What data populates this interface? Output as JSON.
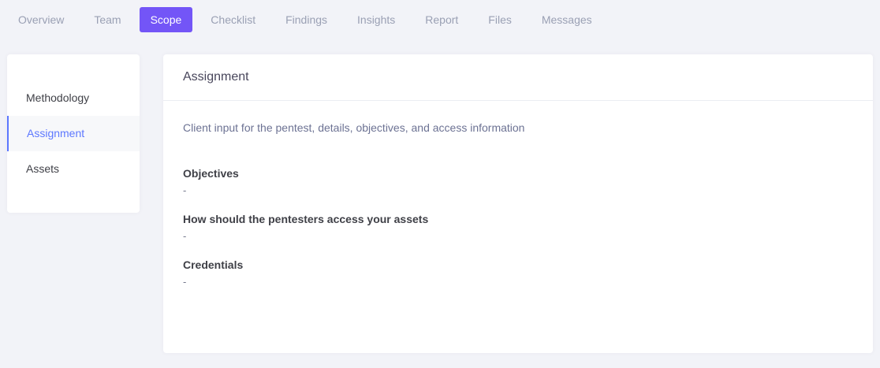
{
  "tabs": [
    {
      "label": "Overview"
    },
    {
      "label": "Team"
    },
    {
      "label": "Scope"
    },
    {
      "label": "Checklist"
    },
    {
      "label": "Findings"
    },
    {
      "label": "Insights"
    },
    {
      "label": "Report"
    },
    {
      "label": "Files"
    },
    {
      "label": "Messages"
    }
  ],
  "active_tab": "Scope",
  "sidebar": {
    "items": [
      {
        "label": "Methodology"
      },
      {
        "label": "Assignment"
      },
      {
        "label": "Assets"
      }
    ],
    "active_item": "Assignment"
  },
  "main": {
    "title": "Assignment",
    "description": "Client input for the pentest, details, objectives, and access information",
    "fields": [
      {
        "label": "Objectives",
        "value": "-"
      },
      {
        "label": "How should the pentesters access your assets",
        "value": "-"
      },
      {
        "label": "Credentials",
        "value": "-"
      }
    ]
  },
  "colors": {
    "accent": "#7355f7",
    "active_link": "#5d78ff",
    "background": "#f2f3f8"
  }
}
